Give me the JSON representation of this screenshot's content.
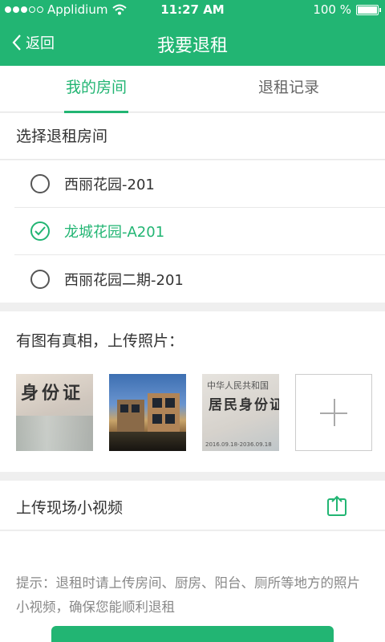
{
  "status_bar": {
    "carrier": "Applidium",
    "time": "11:27 AM",
    "battery": "100 %",
    "battery_level": 1.0
  },
  "nav": {
    "back_label": "返回",
    "title": "我要退租"
  },
  "tabs": [
    {
      "label": "我的房间",
      "active": true
    },
    {
      "label": "退租记录",
      "active": false
    }
  ],
  "room_section": {
    "title": "选择退租房间",
    "rooms": [
      {
        "label": "西丽花园-201",
        "checked": false
      },
      {
        "label": "龙城花园-A201",
        "checked": true
      },
      {
        "label": "西丽花园二期-201",
        "checked": false
      }
    ]
  },
  "photo_section": {
    "title": "有图有真相，上传照片：",
    "photos": [
      {
        "kind": "id-card-front",
        "caption": "身份证"
      },
      {
        "kind": "building-photo"
      },
      {
        "kind": "id-card-back",
        "line1": "中华人民共和国",
        "line2": "居民身份证",
        "line3": "2016.09.18-2036.09.18"
      }
    ]
  },
  "video_section": {
    "label": "上传现场小视频"
  },
  "tips": "提示：退租时请上传房间、厨房、阳台、厕所等地方的照片小视频，确保您能顺利退租",
  "colors": {
    "accent": "#22b573",
    "text": "#333333",
    "muted": "#888888"
  }
}
